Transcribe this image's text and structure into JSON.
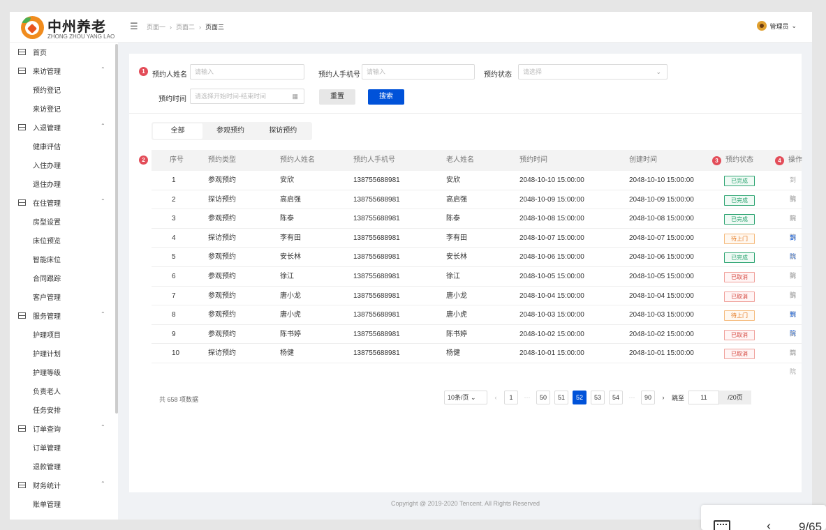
{
  "logo": {
    "cn": "中州养老",
    "en": "ZHONG ZHOU YANG LAO"
  },
  "breadcrumb": [
    "页面一",
    "页面二",
    "页面三"
  ],
  "user": {
    "name": "管理员"
  },
  "sidebar": {
    "home": "首页",
    "groups": [
      {
        "label": "来访管理",
        "items": [
          "预约登记",
          "来访登记"
        ]
      },
      {
        "label": "入退管理",
        "items": [
          "健康评估",
          "入住办理",
          "退住办理"
        ]
      },
      {
        "label": "在住管理",
        "items": [
          "房型设置",
          "床位预览",
          "智能床位",
          "合同跟踪",
          "客户管理"
        ]
      },
      {
        "label": "服务管理",
        "items": [
          "护理项目",
          "护理计划",
          "护理等级",
          "负责老人",
          "任务安排"
        ]
      },
      {
        "label": "订单查询",
        "items": [
          "订单管理",
          "退款管理"
        ]
      },
      {
        "label": "财务统计",
        "items": [
          "账单管理"
        ]
      }
    ]
  },
  "badges": [
    "1",
    "2",
    "3",
    "4"
  ],
  "filters": {
    "name_label": "预约人姓名",
    "name_placeholder": "请输入",
    "phone_label": "预约人手机号",
    "phone_placeholder": "请输入",
    "status_label": "预约状态",
    "status_placeholder": "请选择",
    "time_label": "预约时间",
    "time_placeholder": "请选择开始时间-结束时间",
    "reset": "重置",
    "search": "搜索"
  },
  "tabs": [
    "全部",
    "参观预约",
    "探访预约"
  ],
  "table": {
    "headers": [
      "序号",
      "预约类型",
      "预约人姓名",
      "预约人手机号",
      "老人姓名",
      "预约时间",
      "创建时间",
      "预约状态",
      "操作"
    ],
    "rows": [
      {
        "no": "1",
        "type": "参观预约",
        "name": "安欣",
        "phone": "138755688981",
        "elder": "安欣",
        "time": "2048-10-10 15:00:00",
        "created": "2048-10-10 15:00:00",
        "status": "已完成",
        "status_kind": "done",
        "op": "到院",
        "op_active": false
      },
      {
        "no": "2",
        "type": "探访预约",
        "name": "高启强",
        "phone": "138755688981",
        "elder": "高启强",
        "time": "2048-10-09 15:00:00",
        "created": "2048-10-09 15:00:00",
        "status": "已完成",
        "status_kind": "done",
        "op": "到院",
        "op_active": false
      },
      {
        "no": "3",
        "type": "参观预约",
        "name": "陈泰",
        "phone": "138755688981",
        "elder": "陈泰",
        "time": "2048-10-08 15:00:00",
        "created": "2048-10-08 15:00:00",
        "status": "已完成",
        "status_kind": "done",
        "op": "到院",
        "op_active": false
      },
      {
        "no": "4",
        "type": "探访预约",
        "name": "李有田",
        "phone": "138755688981",
        "elder": "李有田",
        "time": "2048-10-07 15:00:00",
        "created": "2048-10-07 15:00:00",
        "status": "待上门",
        "status_kind": "wait",
        "op": "到院",
        "op_active": true
      },
      {
        "no": "5",
        "type": "参观预约",
        "name": "安长林",
        "phone": "138755688981",
        "elder": "安长林",
        "time": "2048-10-06 15:00:00",
        "created": "2048-10-06 15:00:00",
        "status": "已完成",
        "status_kind": "done",
        "op": "到院",
        "op_active": false
      },
      {
        "no": "6",
        "type": "参观预约",
        "name": "徐江",
        "phone": "138755688981",
        "elder": "徐江",
        "time": "2048-10-05 15:00:00",
        "created": "2048-10-05 15:00:00",
        "status": "已取消",
        "status_kind": "cancel",
        "op": "到院",
        "op_active": false
      },
      {
        "no": "7",
        "type": "参观预约",
        "name": "唐小龙",
        "phone": "138755688981",
        "elder": "唐小龙",
        "time": "2048-10-04 15:00:00",
        "created": "2048-10-04 15:00:00",
        "status": "已取消",
        "status_kind": "cancel",
        "op": "到院",
        "op_active": false
      },
      {
        "no": "8",
        "type": "参观预约",
        "name": "唐小虎",
        "phone": "138755688981",
        "elder": "唐小虎",
        "time": "2048-10-03 15:00:00",
        "created": "2048-10-03 15:00:00",
        "status": "待上门",
        "status_kind": "wait",
        "op": "到院",
        "op_active": true
      },
      {
        "no": "9",
        "type": "参观预约",
        "name": "陈书婷",
        "phone": "138755688981",
        "elder": "陈书婷",
        "time": "2048-10-02 15:00:00",
        "created": "2048-10-02 15:00:00",
        "status": "已取消",
        "status_kind": "cancel",
        "op": "到院",
        "op_active": false
      },
      {
        "no": "10",
        "type": "探访预约",
        "name": "杨健",
        "phone": "138755688981",
        "elder": "杨健",
        "time": "2048-10-01 15:00:00",
        "created": "2048-10-01 15:00:00",
        "status": "已取消",
        "status_kind": "cancel",
        "op": "到院",
        "op_active": false
      }
    ]
  },
  "pagination": {
    "total_text": "共 658 项数据",
    "page_size": "10条/页",
    "pages_left": [
      "1"
    ],
    "pages_mid": [
      "50",
      "51",
      "52",
      "53",
      "54"
    ],
    "current": "52",
    "pages_right": [
      "90"
    ],
    "jump_label": "跳至",
    "jump_value": "11",
    "jump_total": "/20页"
  },
  "footer": "Copyright @ 2019-2020 Tencent. All Rights Reserved",
  "floater": {
    "page_count": "9/65"
  },
  "colors": {
    "primary": "#0052d9",
    "success": "#2ba471",
    "warning": "#e37318",
    "danger": "#d54941",
    "badge": "#e34d59"
  }
}
